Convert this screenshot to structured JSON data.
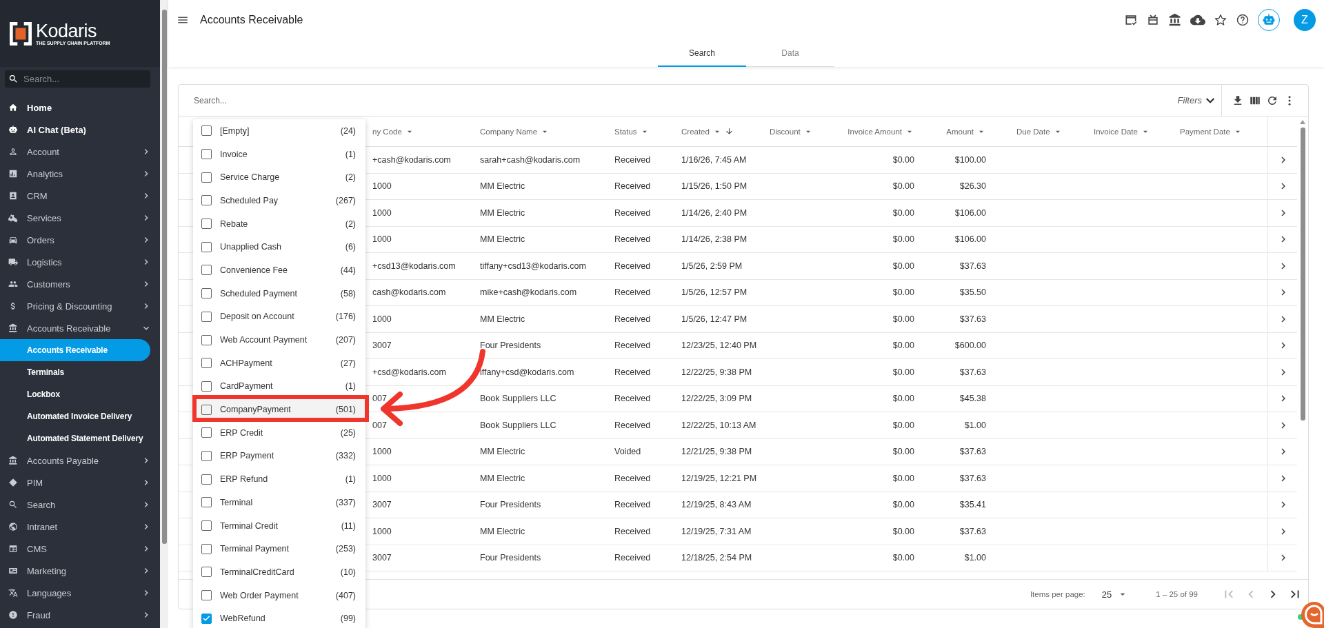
{
  "logo": {
    "name": "Kodaris",
    "tagline": "THE SUPPLY CHAIN PLATFORM"
  },
  "sidebar": {
    "search_placeholder": "Search...",
    "items": [
      {
        "label": "Home",
        "kind": "link"
      },
      {
        "label": "AI Chat (Beta)",
        "kind": "link"
      },
      {
        "label": "Account",
        "kind": "group",
        "expanded": false
      },
      {
        "label": "Analytics",
        "kind": "group",
        "expanded": false
      },
      {
        "label": "CRM",
        "kind": "group",
        "expanded": false
      },
      {
        "label": "Services",
        "kind": "group",
        "expanded": false
      },
      {
        "label": "Orders",
        "kind": "group",
        "expanded": false
      },
      {
        "label": "Logistics",
        "kind": "group",
        "expanded": false
      },
      {
        "label": "Customers",
        "kind": "group",
        "expanded": false
      },
      {
        "label": "Pricing & Discounting",
        "kind": "group",
        "expanded": false
      },
      {
        "label": "Accounts Receivable",
        "kind": "group",
        "expanded": true,
        "children": [
          {
            "label": "Accounts Receivable",
            "selected": true
          },
          {
            "label": "Terminals",
            "selected": false
          },
          {
            "label": "Lockbox",
            "selected": false
          },
          {
            "label": "Automated Invoice Delivery",
            "selected": false
          },
          {
            "label": "Automated Statement Delivery",
            "selected": false
          }
        ]
      },
      {
        "label": "Accounts Payable",
        "kind": "group",
        "expanded": false
      },
      {
        "label": "PIM",
        "kind": "group",
        "expanded": false
      },
      {
        "label": "Search",
        "kind": "group",
        "expanded": false
      },
      {
        "label": "Intranet",
        "kind": "group",
        "expanded": false
      },
      {
        "label": "CMS",
        "kind": "group",
        "expanded": false
      },
      {
        "label": "Marketing",
        "kind": "group",
        "expanded": false
      },
      {
        "label": "Languages",
        "kind": "group",
        "expanded": false
      },
      {
        "label": "Fraud",
        "kind": "group",
        "expanded": false
      }
    ]
  },
  "header": {
    "title": "Accounts Receivable",
    "avatar": "Z"
  },
  "tabs": [
    {
      "label": "Search",
      "selected": true
    },
    {
      "label": "Data",
      "selected": false
    }
  ],
  "toolbar": {
    "search_placeholder": "Search...",
    "filters": "Filters"
  },
  "table": {
    "columns": [
      {
        "label": "ny Code",
        "kind": "text",
        "sorted": false
      },
      {
        "label": "Company Name",
        "kind": "text",
        "sorted": false
      },
      {
        "label": "Status",
        "kind": "text",
        "sorted": false
      },
      {
        "label": "Created",
        "kind": "text",
        "sorted": true
      },
      {
        "label": "Discount",
        "kind": "text",
        "sorted": false
      },
      {
        "label": "Invoice Amount",
        "kind": "amount",
        "sorted": false
      },
      {
        "label": "Amount",
        "kind": "amount",
        "sorted": false
      },
      {
        "label": "Due Date",
        "kind": "text",
        "sorted": false
      },
      {
        "label": "Invoice Date",
        "kind": "text",
        "sorted": false
      },
      {
        "label": "Payment Date",
        "kind": "text",
        "sorted": false
      }
    ],
    "rows": [
      {
        "code": "+cash@kodaris.com",
        "company": "sarah+cash@kodaris.com",
        "status": "Received",
        "created": "1/16/26, 7:45 AM",
        "invoice_amount": "$0.00",
        "amount": "$100.00"
      },
      {
        "code": "1000",
        "company": "MM Electric",
        "status": "Received",
        "created": "1/15/26, 1:50 PM",
        "invoice_amount": "$0.00",
        "amount": "$26.30"
      },
      {
        "code": "1000",
        "company": "MM Electric",
        "status": "Received",
        "created": "1/14/26, 2:40 PM",
        "invoice_amount": "$0.00",
        "amount": "$106.00"
      },
      {
        "code": "1000",
        "company": "MM Electric",
        "status": "Received",
        "created": "1/14/26, 2:38 PM",
        "invoice_amount": "$0.00",
        "amount": "$106.00"
      },
      {
        "code": "+csd13@kodaris.com",
        "company": "tiffany+csd13@kodaris.com",
        "status": "Received",
        "created": "1/5/26, 2:59 PM",
        "invoice_amount": "$0.00",
        "amount": "$37.63"
      },
      {
        "code": "cash@kodaris.com",
        "company": "mike+cash@kodaris.com",
        "status": "Received",
        "created": "1/5/26, 12:57 PM",
        "invoice_amount": "$0.00",
        "amount": "$35.50"
      },
      {
        "code": "1000",
        "company": "MM Electric",
        "status": "Received",
        "created": "1/5/26, 12:47 PM",
        "invoice_amount": "$0.00",
        "amount": "$37.63"
      },
      {
        "code": "3007",
        "company": "Four Presidents",
        "status": "Received",
        "created": "12/23/25, 12:40 PM",
        "invoice_amount": "$0.00",
        "amount": "$600.00"
      },
      {
        "code": "+csd@kodaris.com",
        "company": "iffany+csd@kodaris.com",
        "status": "Received",
        "created": "12/22/25, 9:38 PM",
        "invoice_amount": "$0.00",
        "amount": "$37.63"
      },
      {
        "code": "007",
        "company": "Book Suppliers LLC",
        "status": "Received",
        "created": "12/22/25, 3:09 PM",
        "invoice_amount": "$0.00",
        "amount": "$45.38"
      },
      {
        "code": "007",
        "company": "Book Suppliers LLC",
        "status": "Received",
        "created": "12/22/25, 10:13 AM",
        "invoice_amount": "$0.00",
        "amount": "$1.00"
      },
      {
        "code": "1000",
        "company": "MM Electric",
        "status": "Voided",
        "created": "12/21/25, 9:38 PM",
        "invoice_amount": "$0.00",
        "amount": "$37.63"
      },
      {
        "code": "1000",
        "company": "MM Electric",
        "status": "Received",
        "created": "12/19/25, 12:21 PM",
        "invoice_amount": "$0.00",
        "amount": "$37.63"
      },
      {
        "code": "3007",
        "company": "Four Presidents",
        "status": "Received",
        "created": "12/19/25, 8:43 AM",
        "invoice_amount": "$0.00",
        "amount": "$35.41"
      },
      {
        "code": "1000",
        "company": "MM Electric",
        "status": "Received",
        "created": "12/19/25, 7:31 AM",
        "invoice_amount": "$0.00",
        "amount": "$37.63"
      },
      {
        "code": "3007",
        "company": "Four Presidents",
        "status": "Received",
        "created": "12/18/25, 2:54 PM",
        "invoice_amount": "$0.00",
        "amount": "$1.00"
      }
    ]
  },
  "filter_menu": {
    "items": [
      {
        "label": "[Empty]",
        "count": "(24)",
        "checked": false,
        "highlighted": false
      },
      {
        "label": "Invoice",
        "count": "(1)",
        "checked": false,
        "highlighted": false
      },
      {
        "label": "Service Charge",
        "count": "(2)",
        "checked": false,
        "highlighted": false
      },
      {
        "label": "Scheduled Pay",
        "count": "(267)",
        "checked": false,
        "highlighted": false
      },
      {
        "label": "Rebate",
        "count": "(2)",
        "checked": false,
        "highlighted": false
      },
      {
        "label": "Unapplied Cash",
        "count": "(6)",
        "checked": false,
        "highlighted": false
      },
      {
        "label": "Convenience Fee",
        "count": "(44)",
        "checked": false,
        "highlighted": false
      },
      {
        "label": "Scheduled Payment",
        "count": "(58)",
        "checked": false,
        "highlighted": false
      },
      {
        "label": "Deposit on Account",
        "count": "(176)",
        "checked": false,
        "highlighted": false
      },
      {
        "label": "Web Account Payment",
        "count": "(207)",
        "checked": false,
        "highlighted": false
      },
      {
        "label": "ACHPayment",
        "count": "(27)",
        "checked": false,
        "highlighted": false
      },
      {
        "label": "CardPayment",
        "count": "(1)",
        "checked": false,
        "highlighted": false
      },
      {
        "label": "CompanyPayment",
        "count": "(501)",
        "checked": false,
        "highlighted": true
      },
      {
        "label": "ERP Credit",
        "count": "(25)",
        "checked": false,
        "highlighted": false
      },
      {
        "label": "ERP Payment",
        "count": "(332)",
        "checked": false,
        "highlighted": false
      },
      {
        "label": "ERP Refund",
        "count": "(1)",
        "checked": false,
        "highlighted": false
      },
      {
        "label": "Terminal",
        "count": "(337)",
        "checked": false,
        "highlighted": false
      },
      {
        "label": "Terminal Credit",
        "count": "(11)",
        "checked": false,
        "highlighted": false
      },
      {
        "label": "Terminal Payment",
        "count": "(253)",
        "checked": false,
        "highlighted": false
      },
      {
        "label": "TerminalCreditCard",
        "count": "(10)",
        "checked": false,
        "highlighted": false
      },
      {
        "label": "Web Order Payment",
        "count": "(407)",
        "checked": false,
        "highlighted": false
      },
      {
        "label": "WebRefund",
        "count": "(99)",
        "checked": true,
        "highlighted": false
      }
    ]
  },
  "pagination": {
    "label": "Items per page:",
    "page_size": "25",
    "range": "1 – 25 of 99"
  }
}
